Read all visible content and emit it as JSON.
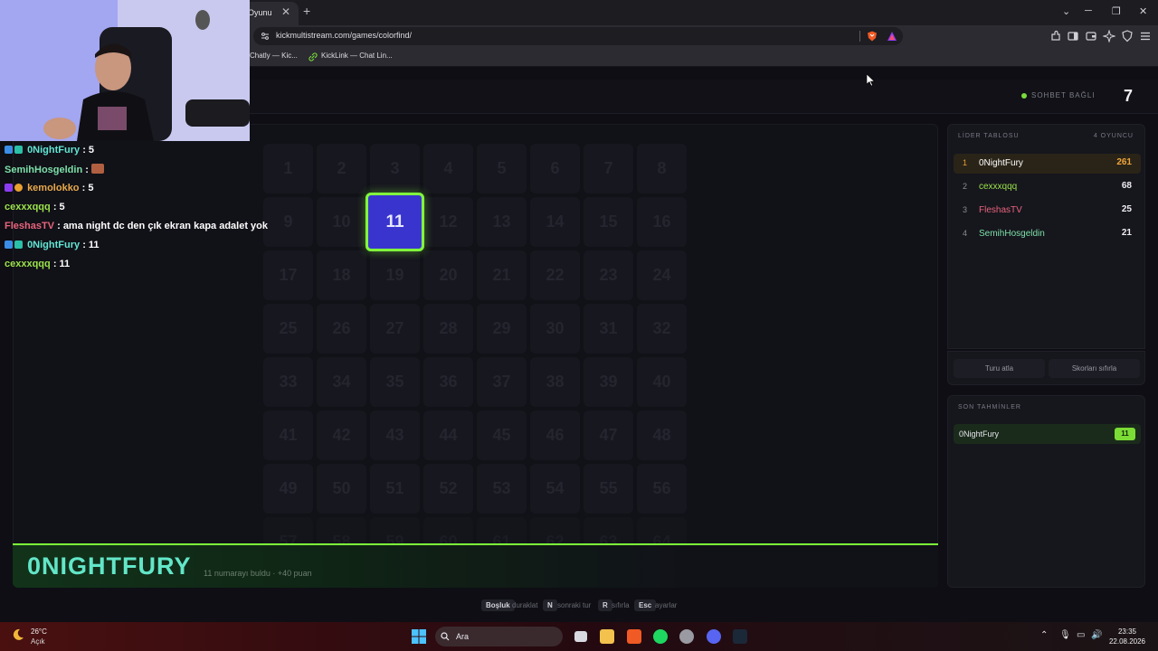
{
  "browser": {
    "active_tab_title": "Oyunu",
    "url": "kickmultistream.com/games/colorfind/",
    "bookmarks": [
      "Chatly — Kic...",
      "KickLink — Chat Lin..."
    ]
  },
  "header": {
    "status": "SOHBET BAĞLI",
    "round": "7"
  },
  "board": {
    "cells": [
      "1",
      "2",
      "3",
      "4",
      "5",
      "6",
      "7",
      "8",
      "9",
      "10",
      "11",
      "12",
      "13",
      "14",
      "15",
      "16",
      "17",
      "18",
      "19",
      "20",
      "21",
      "22",
      "23",
      "24",
      "25",
      "26",
      "27",
      "28",
      "29",
      "30",
      "31",
      "32",
      "33",
      "34",
      "35",
      "36",
      "37",
      "38",
      "39",
      "40",
      "41",
      "42",
      "43",
      "44",
      "45",
      "46",
      "47",
      "48",
      "49",
      "50",
      "51",
      "52",
      "53",
      "54",
      "55",
      "56",
      "57",
      "58",
      "59",
      "60",
      "61",
      "62",
      "63",
      "64"
    ],
    "active_cell": "11",
    "active_color": "#3a34cf",
    "highlight_color": "#82ff3c"
  },
  "winner": {
    "name": "0NIGHTFURY",
    "message": "11 numarayı buldu · +40 puan"
  },
  "leaderboard": {
    "title": "LİDER TABLOSU",
    "count": "4 OYUNCU",
    "rows": [
      {
        "rank": "1",
        "name": "0NightFury",
        "score": "261",
        "color": "#ffffff"
      },
      {
        "rank": "2",
        "name": "cexxxqqq",
        "score": "68",
        "color": "#9be34a"
      },
      {
        "rank": "3",
        "name": "FleshasTV",
        "score": "25",
        "color": "#e8647c"
      },
      {
        "rank": "4",
        "name": "SemihHosgeldin",
        "score": "21",
        "color": "#7de0a8"
      }
    ],
    "skip_label": "Turu atla",
    "reset_label": "Skorları sıfırla"
  },
  "recent": {
    "title": "SON TAHMİNLER",
    "entries": [
      {
        "name": "0NightFury",
        "guess": "11"
      }
    ]
  },
  "shortcuts": [
    {
      "key": "Boşluk",
      "desc": "duraklat"
    },
    {
      "key": "N",
      "desc": "sonraki tur"
    },
    {
      "key": "R",
      "desc": "sıfırla"
    },
    {
      "key": "Esc",
      "desc": "ayarlar"
    }
  ],
  "chat": [
    {
      "user": "0NightFury",
      "text": ": 5",
      "color": "#62e6d4"
    },
    {
      "user": "SemihHosgeldin",
      "text": ":",
      "color": "#7de0a8"
    },
    {
      "user": "kemolokko",
      "text": ": 5",
      "color": "#e8a94a"
    },
    {
      "user": "cexxxqqq",
      "text": ": 5",
      "color": "#9be34a"
    },
    {
      "user": "FleshasTV",
      "text": ": ama night dc den çık ekran kapa adalet yok",
      "color": "#e8647c"
    },
    {
      "user": "0NightFury",
      "text": ": 11",
      "color": "#62e6d4"
    },
    {
      "user": "cexxxqqq",
      "text": ": 11",
      "color": "#9be34a"
    }
  ],
  "taskbar": {
    "temp": "26°C",
    "weather": "Açık",
    "search": "Ara",
    "time": "23:35",
    "date": "22.08.2026"
  }
}
